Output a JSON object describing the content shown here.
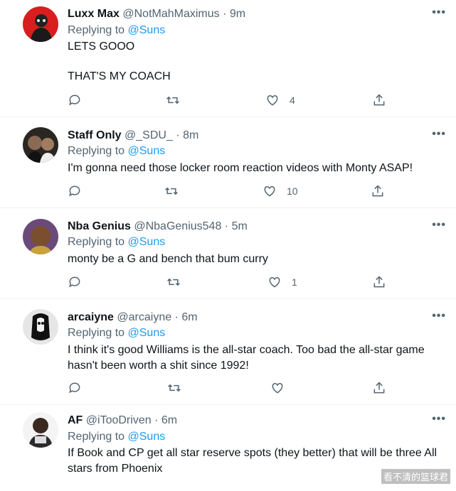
{
  "tweets": [
    {
      "name": "Luxx Max",
      "handle": "@NotMahMaximus",
      "time": "9m",
      "replying_label": "Replying to",
      "mention": "@Suns",
      "body_lines": [
        "LETS GOOO",
        "",
        "THAT'S MY COACH"
      ],
      "likes": "4",
      "avatar": "luxx-avatar"
    },
    {
      "name": "Staff Only",
      "handle": "@_SDU_",
      "time": "8m",
      "replying_label": "Replying to",
      "mention": "@Suns",
      "body_lines": [
        "I'm gonna need those locker room reaction videos with Monty ASAP!"
      ],
      "likes": "10",
      "avatar": "staff-avatar"
    },
    {
      "name": "Nba Genius",
      "handle": "@NbaGenius548",
      "time": "5m",
      "replying_label": "Replying to",
      "mention": "@Suns",
      "body_lines": [
        "monty be a G and bench that bum curry"
      ],
      "likes": "1",
      "avatar": "genius-avatar"
    },
    {
      "name": "arcaiyne",
      "handle": "@arcaiyne",
      "time": "6m",
      "replying_label": "Replying to",
      "mention": "@Suns",
      "body_lines": [
        "I think it's good Williams is the all-star coach. Too bad the all-star game",
        "hasn't been worth a shit since 1992!"
      ],
      "likes": "",
      "avatar": "arcaiyne-avatar"
    },
    {
      "name": "AF",
      "handle": "@iTooDriven",
      "time": "6m",
      "replying_label": "Replying to",
      "mention": "@Suns",
      "body_lines": [
        "If Book and CP get all star reserve spots (they better) that will be three All",
        "stars from Phoenix"
      ],
      "likes": "",
      "avatar": "af-avatar"
    }
  ],
  "separator": "·",
  "more_label": "•••",
  "watermark": "看不清的篮球君",
  "icons": [
    "reply-icon",
    "retweet-icon",
    "like-icon",
    "share-icon",
    "more-icon"
  ],
  "colors": {
    "link": "#1d9bf0",
    "muted": "#536471",
    "text": "#0f1419",
    "divider": "#eff3f4"
  }
}
